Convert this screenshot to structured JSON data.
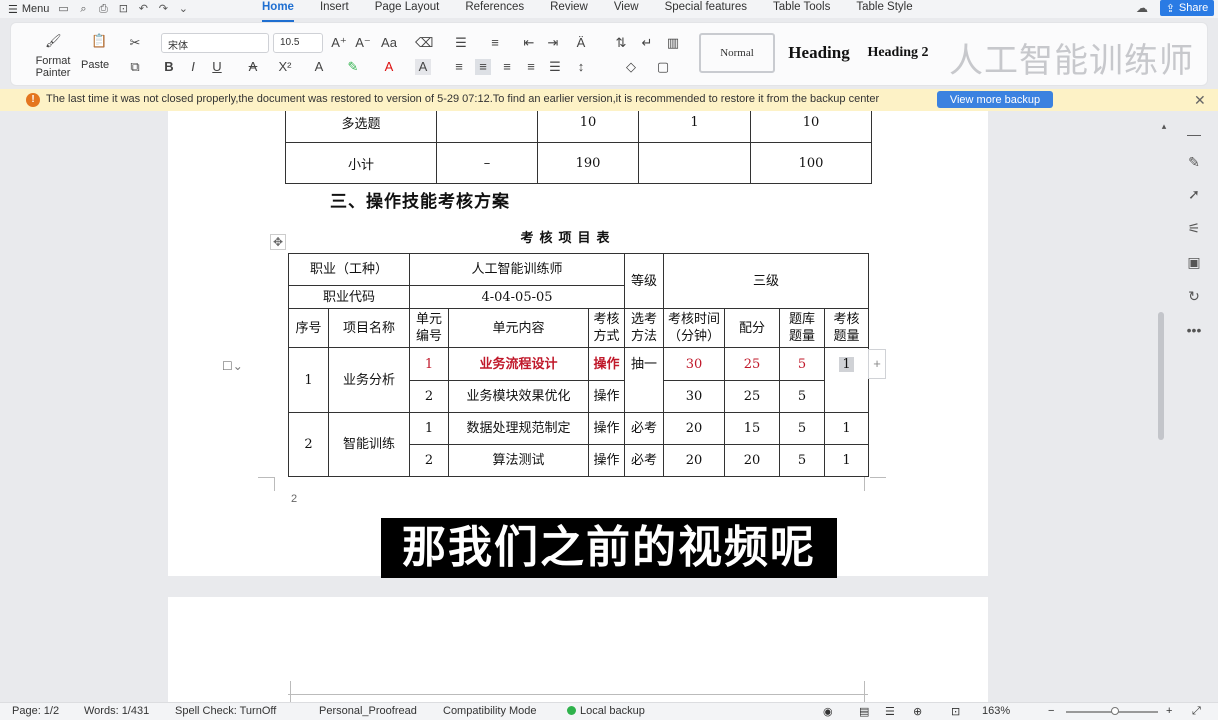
{
  "menubar": {
    "menu_label": "Menu",
    "tabs": [
      "Home",
      "Insert",
      "Page Layout",
      "References",
      "Review",
      "View",
      "Special features",
      "Table Tools",
      "Table Style"
    ],
    "share_label": "Share"
  },
  "ribbon": {
    "format_painter": "Format\nPainter",
    "paste": "Paste",
    "font_name": "宋体",
    "font_size": "10.5",
    "styles": {
      "normal": "Normal",
      "heading": "Heading",
      "heading2": "Heading 2"
    },
    "watermark": "人工智能训练师"
  },
  "notice": {
    "message": "The last time it was not closed properly,the document was restored to version of 5-29 07:12.To find an earlier version,it is recommended to restore it from the backup center",
    "button": "View more backup"
  },
  "table1": {
    "rows": [
      [
        "多选题",
        "",
        "10",
        "1",
        "10"
      ],
      [
        "小计",
        "–",
        "190",
        "",
        "100"
      ]
    ]
  },
  "section_title": "三、操作技能考核方案",
  "table_title": "考核项目表",
  "table2": {
    "occupation_label": "职业（工种）",
    "occupation_value": "人工智能训练师",
    "grade_label": "等级",
    "grade_value": "三级",
    "code_label": "职业代码",
    "code_value": "4-04-05-05",
    "headers": [
      "序号",
      "项目名称",
      "单元\n编号",
      "单元内容",
      "考核\n方式",
      "选考\n方法",
      "考核时间\n（分钟）",
      "配分",
      "题库\n题量",
      "考核\n题量"
    ],
    "groups": [
      {
        "no": "1",
        "name": "业务分析",
        "method": "抽一",
        "rows": [
          {
            "unit": "1",
            "content": "业务流程设计",
            "mode": "操作",
            "time": "30",
            "score": "25",
            "bank": "5",
            "qty": "1"
          },
          {
            "unit": "2",
            "content": "业务模块效果优化",
            "mode": "操作",
            "time": "30",
            "score": "25",
            "bank": "5",
            "qty": ""
          }
        ]
      },
      {
        "no": "2",
        "name": "智能训练",
        "rows": [
          {
            "unit": "1",
            "content": "数据处理规范制定",
            "mode": "操作",
            "method": "必考",
            "time": "20",
            "score": "15",
            "bank": "5",
            "qty": "1"
          },
          {
            "unit": "2",
            "content": "算法测试",
            "mode": "操作",
            "method": "必考",
            "time": "20",
            "score": "20",
            "bank": "5",
            "qty": "1"
          }
        ]
      }
    ]
  },
  "page_number": "2",
  "subtitle": "那我们之前的视频呢",
  "status": {
    "page": "Page: 1/2",
    "words": "Words: 1/431",
    "spell": "Spell Check: TurnOff",
    "proofread": "Personal_Proofread",
    "compat": "Compatibility Mode",
    "backup": "Local backup",
    "zoom": "163%"
  },
  "colors": {
    "accent": "#1f6fd1",
    "notice_bg": "#fdf2c6",
    "highlight_red": "#c0182a"
  }
}
